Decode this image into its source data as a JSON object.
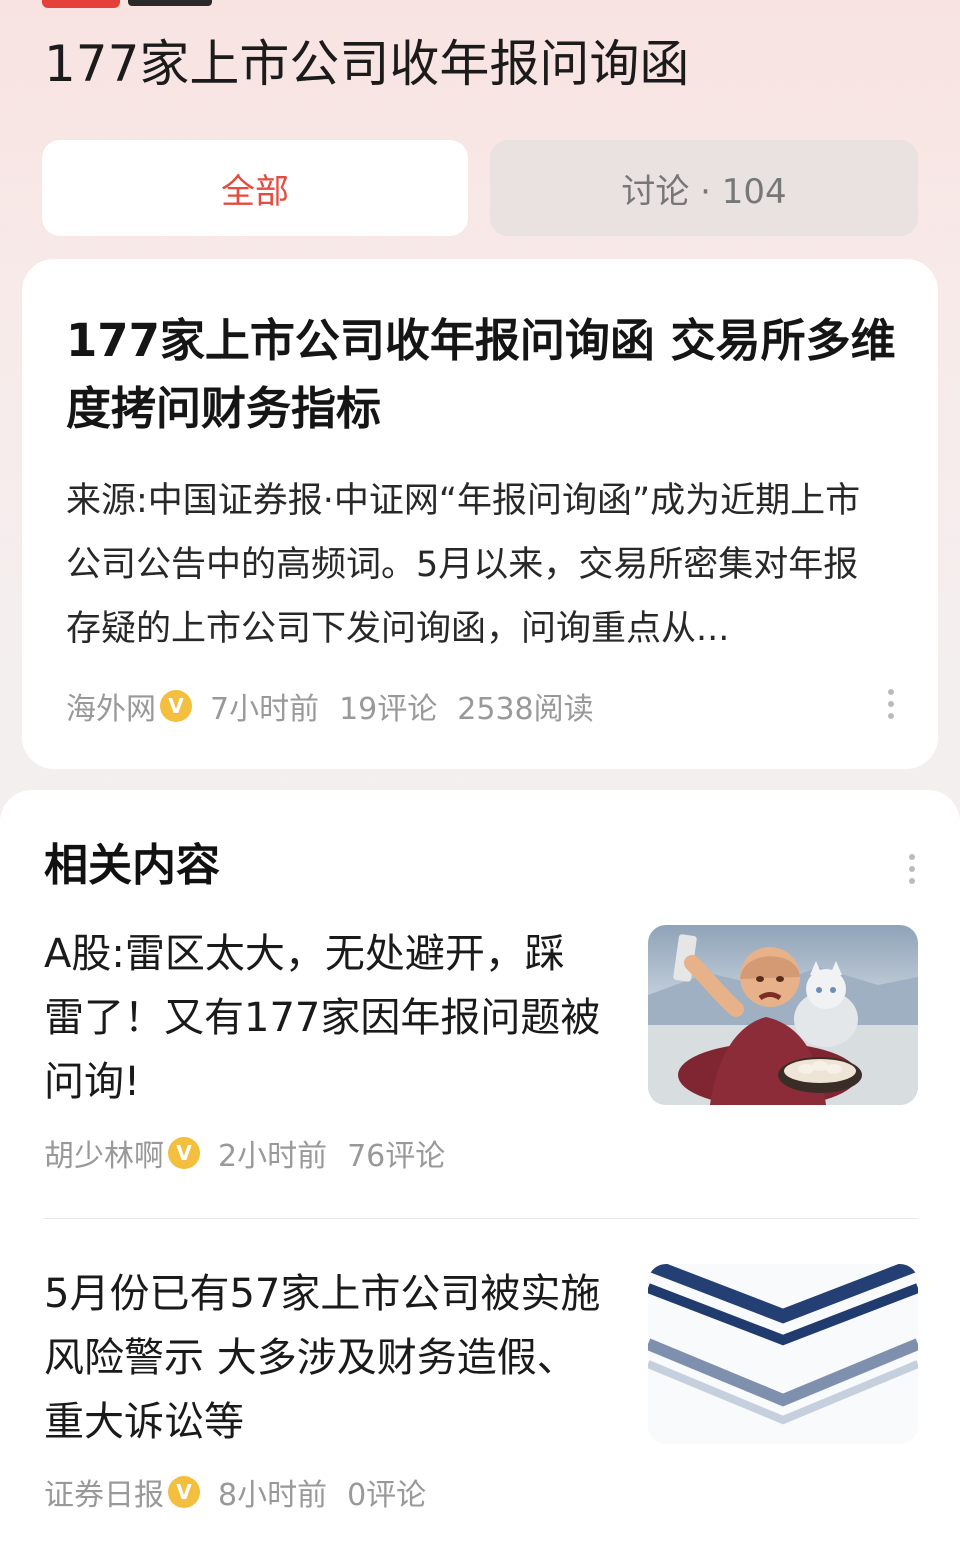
{
  "page": {
    "title": "177家上市公司收年报问询函"
  },
  "tabs": [
    {
      "label": "全部"
    },
    {
      "label": "讨论 · 104"
    }
  ],
  "main_article": {
    "title": "177家上市公司收年报问询函 交易所多维度拷问财务指标",
    "summary": "来源:中国证券报·中证网“年报问询函”成为近期上市公司公告中的高频词。5月以来，交易所密集对年报存疑的上市公司下发问询函，问询重点从...",
    "source": "海外网",
    "verified_badge": "V",
    "time": "7小时前",
    "comments": "19评论",
    "reads": "2538阅读"
  },
  "related": {
    "heading": "相关内容",
    "items": [
      {
        "title": "A股:雷区太大，无处避开，踩雷了！又有177家因年报问题被问询!",
        "source": "胡少林啊",
        "verified_badge": "V",
        "time": "2小时前",
        "comments": "76评论",
        "thumbnail": "crying-monk-with-cat-image"
      },
      {
        "title": "5月份已有57家上市公司被实施风险警示 大多涉及财务造假、重大诉讼等",
        "source": "证券日报",
        "verified_badge": "V",
        "time": "8小时前",
        "comments": "0评论",
        "thumbnail": "chevron-banner-image"
      }
    ]
  },
  "colors": {
    "accent_red": "#e74a3e",
    "verified_badge": "#f4be3e",
    "meta_gray": "#999999"
  }
}
